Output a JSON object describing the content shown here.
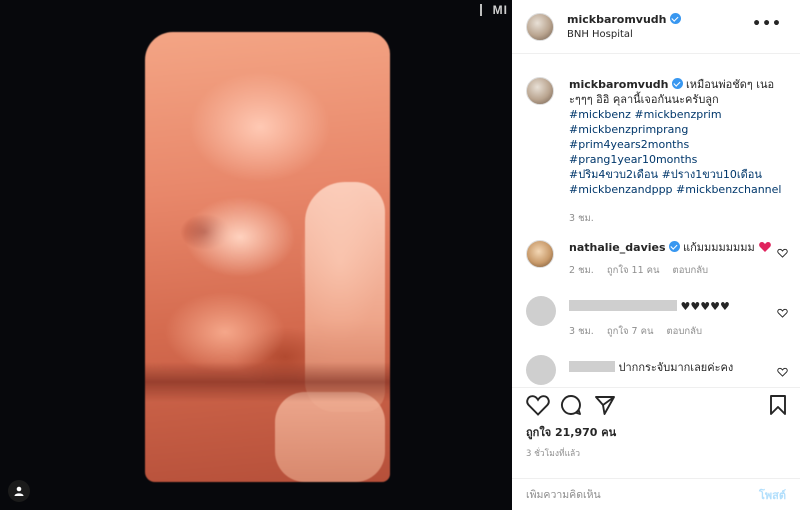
{
  "media": {
    "overlay_text": "MI"
  },
  "header": {
    "username": "mickbaromvudh",
    "location": "BNH Hospital",
    "more_label": "•••"
  },
  "caption": {
    "username": "mickbaromvudh",
    "text": "เหมือนพ่อชัดๆ เนอะๆๆๆ อิอิ คุลานี้เจอกันนะครับลูก",
    "hashtags": [
      "#mickbenz #mickbenzprim",
      "#mickbenzprimprang",
      "#prim4years2months",
      "#prang1year10months"
    ],
    "hashtags_inline_1": "#ปริม4ขวบ2เดือน",
    "hashtags_inline_2": "#ปราง1ขวบ10เดือน",
    "hashtags_last": "#mickbenzandppp #mickbenzchannel",
    "time": "3 ชม."
  },
  "comments": [
    {
      "username": "nathalie_davies",
      "text": "แก้มมมมมมมม",
      "time": "2 ชม.",
      "likes": "ถูกใจ 11 คน",
      "reply": "ตอบกลับ"
    },
    {
      "username": "",
      "text": "♥♥♥♥♥",
      "time": "3 ชม.",
      "likes": "ถูกใจ 7 คน",
      "reply": "ตอบกลับ"
    },
    {
      "username": "",
      "text": "ปากกระจับมากเลยค่ะคง"
    }
  ],
  "actions": {
    "likes": "ถูกใจ 21,970 คน",
    "posted_ago": "3 ชั่วโมงที่แล้ว"
  },
  "add_comment": {
    "placeholder": "เพิ่มความคิดเห็น",
    "post_label": "โพสต์"
  },
  "colors": {
    "verified": "#3897f0",
    "hashtag": "#00376b",
    "muted": "#8e8e8e",
    "post_disabled": "#b2dffc",
    "heart_red": "#e0245e"
  }
}
